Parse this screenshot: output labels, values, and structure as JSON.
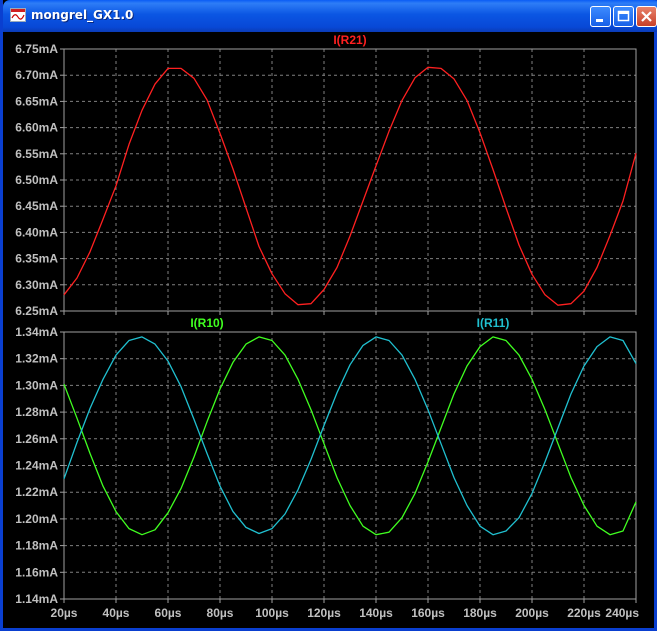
{
  "window": {
    "title": "mongrel_GX1.0",
    "icon": "waveform-app-icon",
    "buttons": [
      "minimize-icon",
      "maximize-icon",
      "close-icon"
    ]
  },
  "colors": {
    "background": "#000000",
    "frame": "#a0a0a0",
    "grid": "#808080",
    "axis_text": "#c0c0c0",
    "R21": "#ff2020",
    "R10": "#40ff20",
    "R11": "#20c0d0"
  },
  "chart_data": [
    {
      "type": "line",
      "title": "",
      "xlabel": "",
      "ylabel": "",
      "x_unit": "µs",
      "y_unit": "mA",
      "xlim": [
        20,
        240
      ],
      "ylim": [
        6.25,
        6.75
      ],
      "grid": true,
      "x_ticks": [
        "20µs",
        "40µs",
        "60µs",
        "80µs",
        "100µs",
        "120µs",
        "140µs",
        "160µs",
        "180µs",
        "200µs",
        "220µs",
        "240µs"
      ],
      "y_ticks": [
        "6.25mA",
        "6.30mA",
        "6.35mA",
        "6.40mA",
        "6.45mA",
        "6.50mA",
        "6.55mA",
        "6.60mA",
        "6.65mA",
        "6.70mA",
        "6.75mA"
      ],
      "series": [
        {
          "name": "I(R21)",
          "color": "#ff2020",
          "x": [
            20,
            25,
            30,
            35,
            40,
            45,
            50,
            55,
            60,
            65,
            70,
            75,
            80,
            85,
            90,
            95,
            100,
            105,
            110,
            115,
            120,
            125,
            130,
            135,
            140,
            145,
            150,
            155,
            160,
            165,
            170,
            175,
            180,
            185,
            190,
            195,
            200,
            205,
            210,
            215,
            220,
            225,
            230,
            235,
            240
          ],
          "y": [
            6.281,
            6.313,
            6.363,
            6.425,
            6.489,
            6.568,
            6.633,
            6.683,
            6.713,
            6.713,
            6.694,
            6.653,
            6.589,
            6.521,
            6.447,
            6.373,
            6.321,
            6.283,
            6.262,
            6.264,
            6.291,
            6.333,
            6.393,
            6.46,
            6.527,
            6.593,
            6.652,
            6.695,
            6.715,
            6.713,
            6.693,
            6.652,
            6.59,
            6.52,
            6.447,
            6.376,
            6.32,
            6.281,
            6.261,
            6.264,
            6.288,
            6.333,
            6.394,
            6.46,
            6.551
          ]
        }
      ]
    },
    {
      "type": "line",
      "title": "",
      "xlabel": "",
      "ylabel": "",
      "x_unit": "µs",
      "y_unit": "mA",
      "xlim": [
        20,
        240
      ],
      "ylim": [
        1.14,
        1.36
      ],
      "grid": true,
      "x_ticks": [
        "20µs",
        "40µs",
        "60µs",
        "80µs",
        "100µs",
        "120µs",
        "140µs",
        "160µs",
        "180µs",
        "200µs",
        "220µs",
        "240µs"
      ],
      "y_ticks": [
        "1.14mA",
        "1.16mA",
        "1.18mA",
        "1.20mA",
        "1.22mA",
        "1.24mA",
        "1.26mA",
        "1.28mA",
        "1.30mA",
        "1.32mA",
        "1.34mA"
      ],
      "series": [
        {
          "name": "I(R10)",
          "color": "#40ff20",
          "x": [
            20,
            25,
            30,
            35,
            40,
            45,
            50,
            55,
            60,
            65,
            70,
            75,
            80,
            85,
            90,
            95,
            100,
            105,
            110,
            115,
            120,
            125,
            130,
            135,
            140,
            145,
            150,
            155,
            160,
            165,
            170,
            175,
            180,
            185,
            190,
            195,
            200,
            205,
            210,
            215,
            220,
            225,
            230,
            235,
            240
          ],
          "y": [
            1.317,
            1.289,
            1.26,
            1.233,
            1.212,
            1.198,
            1.193,
            1.197,
            1.211,
            1.231,
            1.257,
            1.286,
            1.313,
            1.335,
            1.35,
            1.356,
            1.353,
            1.341,
            1.321,
            1.296,
            1.268,
            1.24,
            1.217,
            1.2,
            1.193,
            1.195,
            1.207,
            1.227,
            1.253,
            1.281,
            1.309,
            1.332,
            1.348,
            1.356,
            1.353,
            1.341,
            1.321,
            1.296,
            1.268,
            1.24,
            1.217,
            1.2,
            1.193,
            1.196,
            1.22
          ]
        },
        {
          "name": "I(R11)",
          "color": "#20c0d0",
          "x": [
            20,
            25,
            30,
            35,
            40,
            45,
            50,
            55,
            60,
            65,
            70,
            75,
            80,
            85,
            90,
            95,
            100,
            105,
            110,
            115,
            120,
            125,
            130,
            135,
            140,
            145,
            150,
            155,
            160,
            165,
            170,
            175,
            180,
            185,
            190,
            195,
            200,
            205,
            210,
            215,
            220,
            225,
            230,
            235,
            240
          ],
          "y": [
            1.239,
            1.269,
            1.297,
            1.321,
            1.341,
            1.353,
            1.356,
            1.35,
            1.336,
            1.315,
            1.288,
            1.26,
            1.233,
            1.212,
            1.199,
            1.194,
            1.198,
            1.21,
            1.23,
            1.255,
            1.283,
            1.31,
            1.333,
            1.349,
            1.356,
            1.353,
            1.341,
            1.321,
            1.296,
            1.268,
            1.24,
            1.217,
            1.2,
            1.193,
            1.196,
            1.207,
            1.227,
            1.253,
            1.281,
            1.309,
            1.332,
            1.348,
            1.356,
            1.353,
            1.334
          ]
        }
      ]
    }
  ]
}
